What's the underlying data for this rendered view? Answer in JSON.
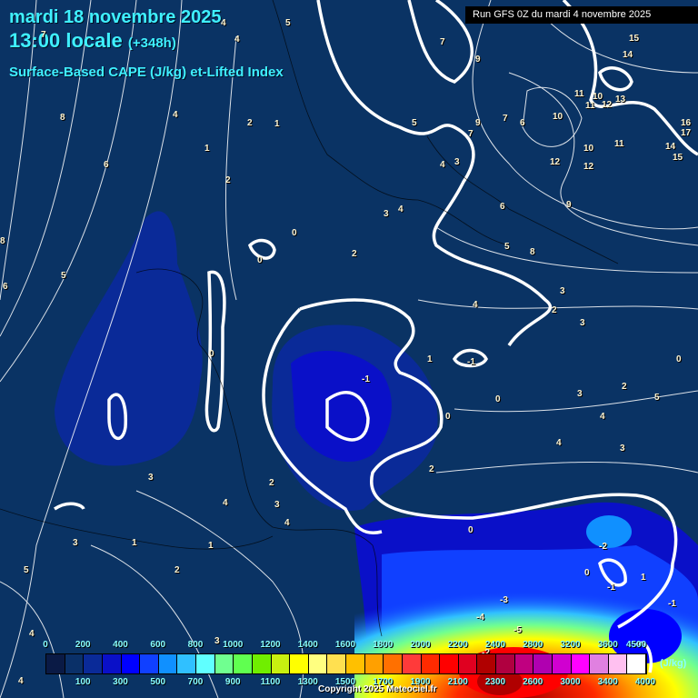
{
  "header": {
    "date": "mardi 18 novembre 2025",
    "time": "13:00 locale",
    "lead": "(+348h)",
    "parameter": "Surface-Based CAPE (J/kg) et-Lifted Index",
    "run": "Run GFS 0Z du mardi 4 novembre 2025"
  },
  "legend": {
    "top_labels": [
      "0",
      "200",
      "400",
      "600",
      "800",
      "1000",
      "1200",
      "1400",
      "1600",
      "1800",
      "2000",
      "2200",
      "2400",
      "2800",
      "3200",
      "3600",
      "4500"
    ],
    "bottom_labels": [
      "100",
      "300",
      "500",
      "700",
      "900",
      "1100",
      "1300",
      "1500",
      "1700",
      "1900",
      "2100",
      "2300",
      "2600",
      "3000",
      "3400",
      "4000"
    ],
    "unit": "(J/kg)",
    "colors": [
      "#0a1a45",
      "#0a3068",
      "#0a2a98",
      "#0a10c8",
      "#0000ff",
      "#1040ff",
      "#1090ff",
      "#30c0ff",
      "#60ffff",
      "#70ff90",
      "#60ff50",
      "#70ee00",
      "#c8f010",
      "#ffff00",
      "#ffff80",
      "#ffe050",
      "#ffc000",
      "#ffa000",
      "#ff7000",
      "#ff3a3a",
      "#ff2a00",
      "#ff0000",
      "#e00020",
      "#b00000",
      "#b00040",
      "#c00080",
      "#b000b0",
      "#d000d0",
      "#ff00ff",
      "#e080e0",
      "#ffc0f0",
      "#ffffff"
    ]
  },
  "lifted_index_labels": [
    "8",
    "7",
    "4",
    "4",
    "5",
    "4",
    "2",
    "1",
    "1",
    "6",
    "2",
    "8",
    "5",
    "6",
    "7",
    "0",
    "0",
    "2",
    "3",
    "4",
    "5",
    "9",
    "7",
    "9",
    "7",
    "6",
    "10",
    "11",
    "10",
    "11",
    "12",
    "13",
    "16",
    "17",
    "14",
    "15",
    "15",
    "14",
    "12",
    "12",
    "10",
    "11",
    "9",
    "6",
    "5",
    "8",
    "4",
    "3",
    "3",
    "4",
    "3",
    "2",
    "0",
    "2",
    "1",
    "-1",
    "0",
    "0",
    "3",
    "2",
    "4",
    "3",
    "5",
    "4",
    "3",
    "4",
    "2",
    "1",
    "0",
    "-1",
    "-2",
    "-3",
    "-4",
    "-5",
    "-2",
    "-1",
    "-1",
    "0",
    "1",
    "0",
    "3",
    "5",
    "4",
    "2",
    "3",
    "1",
    "4",
    "3",
    "4"
  ],
  "copyright": "Copyright 2025 Meteociel.fr"
}
